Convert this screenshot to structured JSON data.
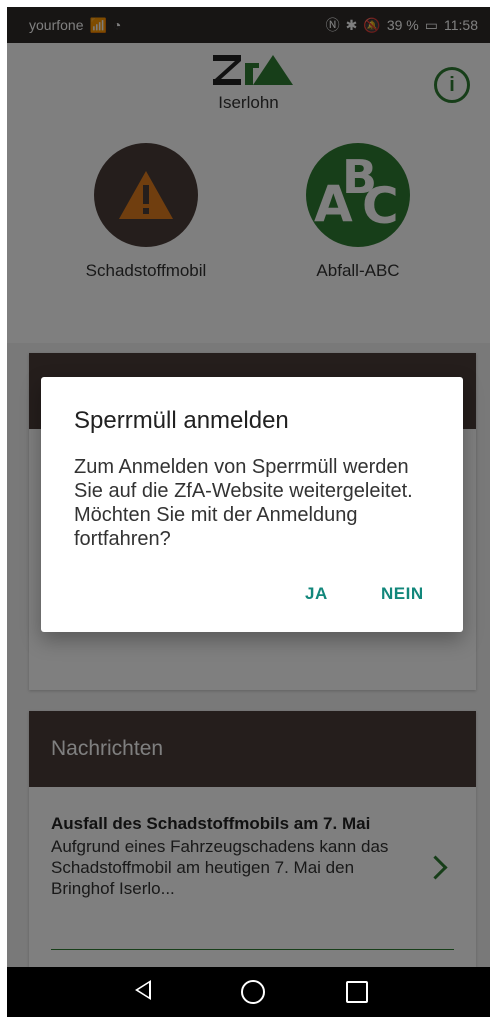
{
  "status_bar": {
    "carrier": "yourfone",
    "battery": "39 %",
    "time": "11:58"
  },
  "header": {
    "logo_text": "ZfA",
    "city": "Iserlohn"
  },
  "tiles": [
    {
      "label": "Schadstoffmobil",
      "icon": "warning-icon"
    },
    {
      "label": "Abfall-ABC",
      "icon": "abc-icon"
    }
  ],
  "cards": {
    "news_title": "Nachrichten",
    "news_item": {
      "title": "Ausfall des Schadstoffmobils am 7. Mai",
      "text": "Aufgrund eines Fahrzeugschadens kann das Schadstoffmobil am heutigen 7. Mai den Bringhof Iserlo..."
    }
  },
  "dialog": {
    "title": "Sperrmüll anmelden",
    "message": "Zum Anmelden von Sperrmüll werden Sie auf die ZfA-Website weitergeleitet. Möchten Sie mit der Anmeldung fortfahren?",
    "yes_label": "JA",
    "no_label": "NEIN"
  },
  "colors": {
    "brand_green": "#2f7d32",
    "brown": "#4a3d38",
    "accent": "#12877b"
  }
}
